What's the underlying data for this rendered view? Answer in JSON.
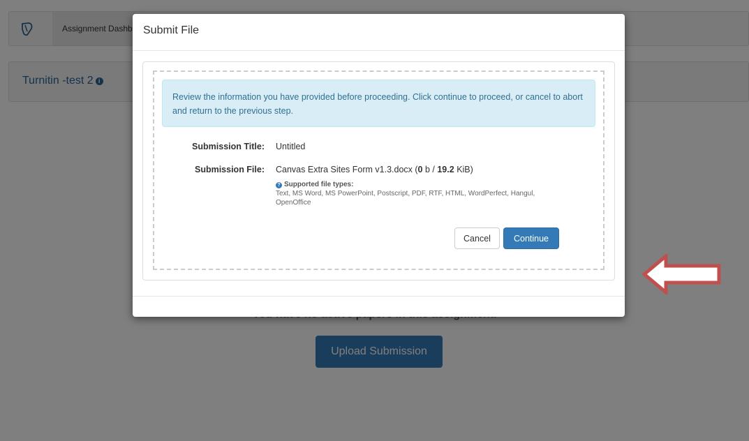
{
  "app": {
    "breadcrumb": "Assignment Dashboard",
    "assignment_title": "Turnitin -test 2",
    "info_icon": "info-circle-icon",
    "empty_message": "You have no active papers in this assignment.",
    "upload_button": "Upload Submission",
    "logo_icon": "turnitin-logo-icon"
  },
  "modal": {
    "title": "Submit File",
    "alert": "Review the information you have provided before proceeding. Click continue to proceed, or cancel to abort and return to the previous step.",
    "submission_title_label": "Submission Title:",
    "submission_title_value": "Untitled",
    "submission_file_label": "Submission File:",
    "file_name": "Canvas Extra Sites Form v1.3.docx",
    "file_progress_done": "0",
    "file_progress_unit": "b",
    "file_size": "19.2",
    "file_size_unit": "KiB",
    "supported_heading": "Supported file types:",
    "supported_list": "Text, MS Word, MS PowerPoint, Postscript, PDF, RTF, HTML, WordPerfect, Hangul, OpenOffice",
    "help_icon": "question-circle-icon",
    "cancel_label": "Cancel",
    "continue_label": "Continue"
  },
  "annotation": {
    "arrow_icon": "left-arrow-outline-icon",
    "arrow_color": "#c0504d"
  },
  "colors": {
    "primary": "#337ab7",
    "alert_bg": "#d9edf7",
    "alert_text": "#31708f"
  }
}
